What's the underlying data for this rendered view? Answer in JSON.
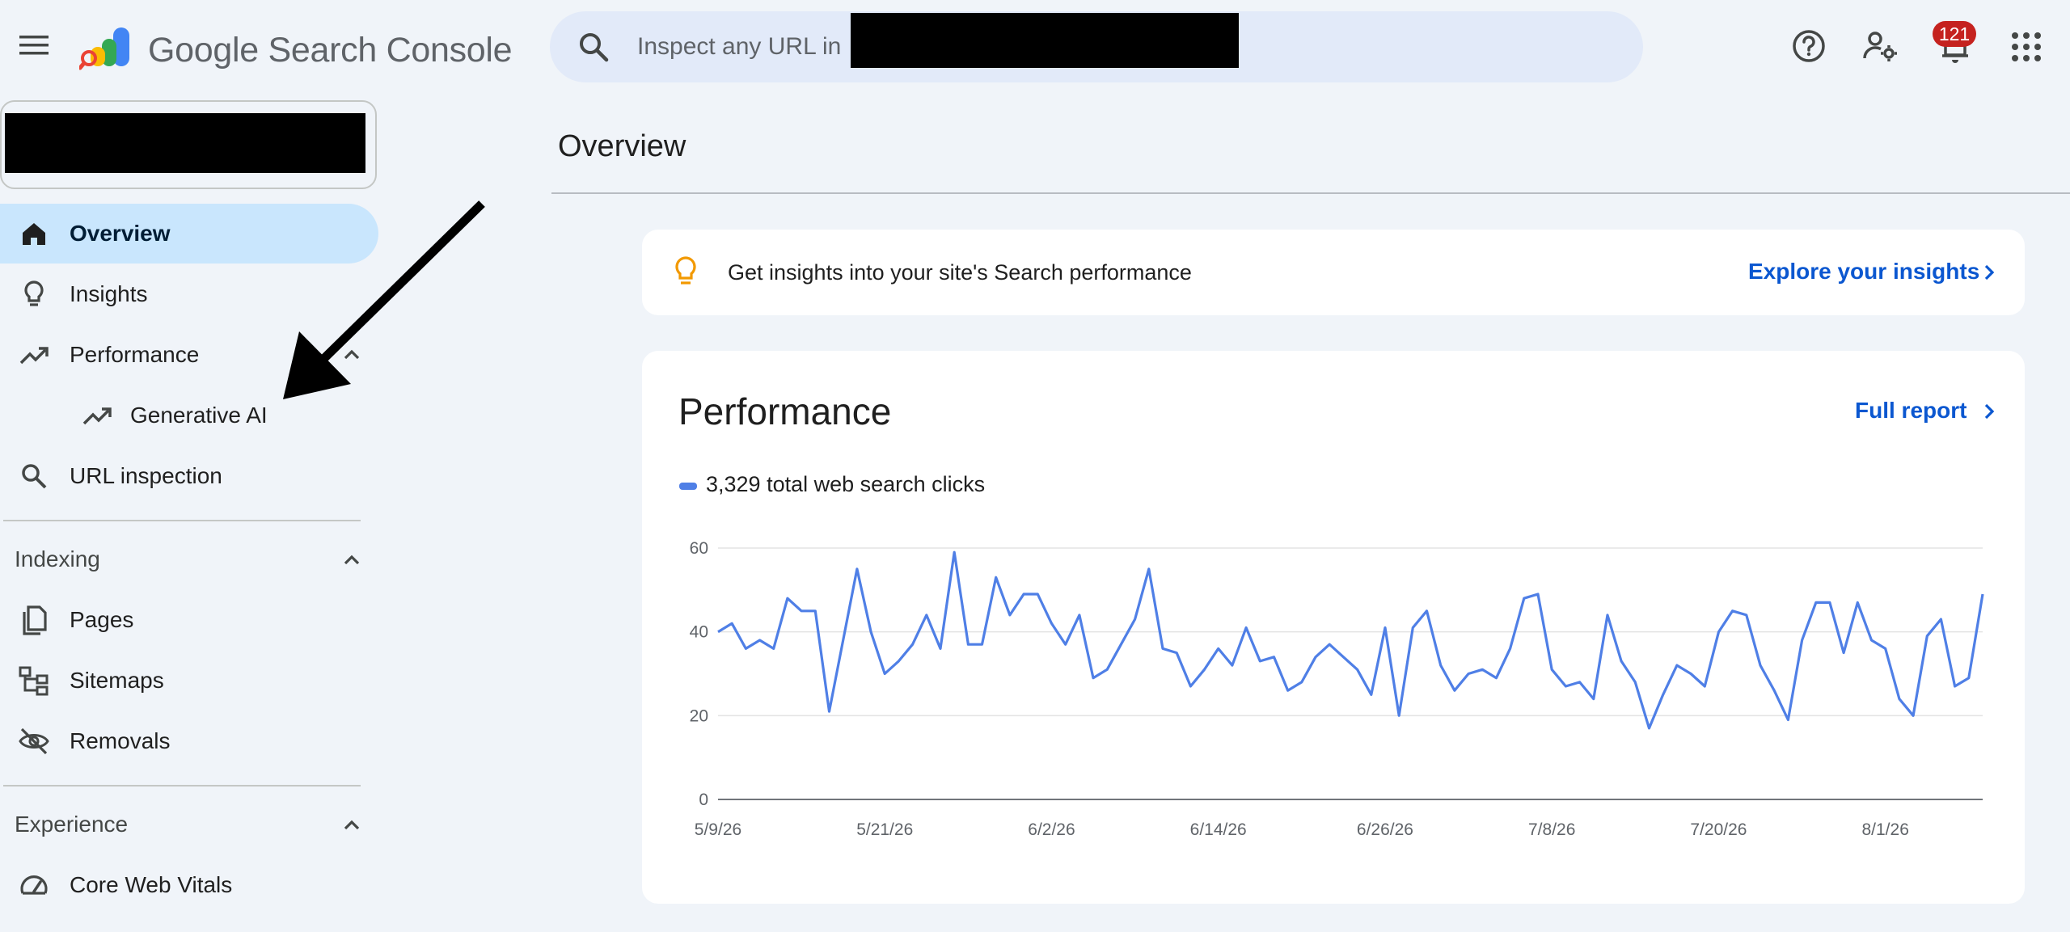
{
  "app": {
    "brand": "Google Search Console",
    "notification_count": "121"
  },
  "search": {
    "placeholder": "Inspect any URL in '"
  },
  "sidebar": {
    "items": [
      {
        "label": "Overview",
        "icon": "home-icon",
        "selected": true
      },
      {
        "label": "Insights",
        "icon": "lightbulb-icon"
      },
      {
        "label": "Performance",
        "icon": "trending-up-icon",
        "expanded": true
      },
      {
        "label": "Generative AI",
        "icon": "trending-up-icon",
        "sub": true
      },
      {
        "label": "URL inspection",
        "icon": "search-icon"
      }
    ],
    "indexing": {
      "title": "Indexing",
      "items": [
        {
          "label": "Pages",
          "icon": "pages-icon"
        },
        {
          "label": "Sitemaps",
          "icon": "sitemap-icon"
        },
        {
          "label": "Removals",
          "icon": "eye-off-icon"
        }
      ]
    },
    "experience": {
      "title": "Experience",
      "items": [
        {
          "label": "Core Web Vitals",
          "icon": "speed-gauge-icon"
        }
      ]
    }
  },
  "main": {
    "title": "Overview",
    "insights_card": {
      "text": "Get insights into your site's Search performance",
      "link": "Explore your insights"
    },
    "performance": {
      "title": "Performance",
      "link": "Full report",
      "legend": "3,329 total web search clicks"
    }
  },
  "colors": {
    "accent": "#0b57d0",
    "series": "#4f7fe6",
    "selected_nav": "#c9e6fd",
    "badge": "#c5221f"
  },
  "chart_data": {
    "type": "line",
    "title": "",
    "xlabel": "",
    "ylabel": "",
    "ylim": [
      0,
      60
    ],
    "yticks": [
      "0",
      "20",
      "40",
      "60"
    ],
    "x_tick_labels": [
      "5/9/26",
      "5/21/26",
      "6/2/26",
      "6/14/26",
      "6/26/26",
      "7/8/26",
      "7/20/26",
      "8/1/26"
    ],
    "x_start": "5/9/26",
    "x_end": "8/11/26",
    "grid": true,
    "legend": "top-left",
    "series": [
      {
        "name": "3,329 total web search clicks",
        "values": [
          40,
          42,
          36,
          38,
          36,
          48,
          45,
          45,
          21,
          38,
          55,
          40,
          30,
          33,
          37,
          44,
          36,
          59,
          37,
          37,
          53,
          44,
          49,
          49,
          42,
          37,
          44,
          29,
          31,
          37,
          43,
          55,
          36,
          35,
          27,
          31,
          36,
          32,
          41,
          33,
          34,
          26,
          28,
          34,
          37,
          34,
          31,
          25,
          41,
          20,
          41,
          45,
          32,
          26,
          30,
          31,
          29,
          36,
          48,
          49,
          31,
          27,
          28,
          24,
          44,
          33,
          28,
          17,
          25,
          32,
          30,
          27,
          40,
          45,
          44,
          32,
          26,
          19,
          38,
          47,
          47,
          35,
          47,
          38,
          36,
          24,
          20,
          39,
          43,
          27,
          29,
          49
        ]
      }
    ]
  }
}
